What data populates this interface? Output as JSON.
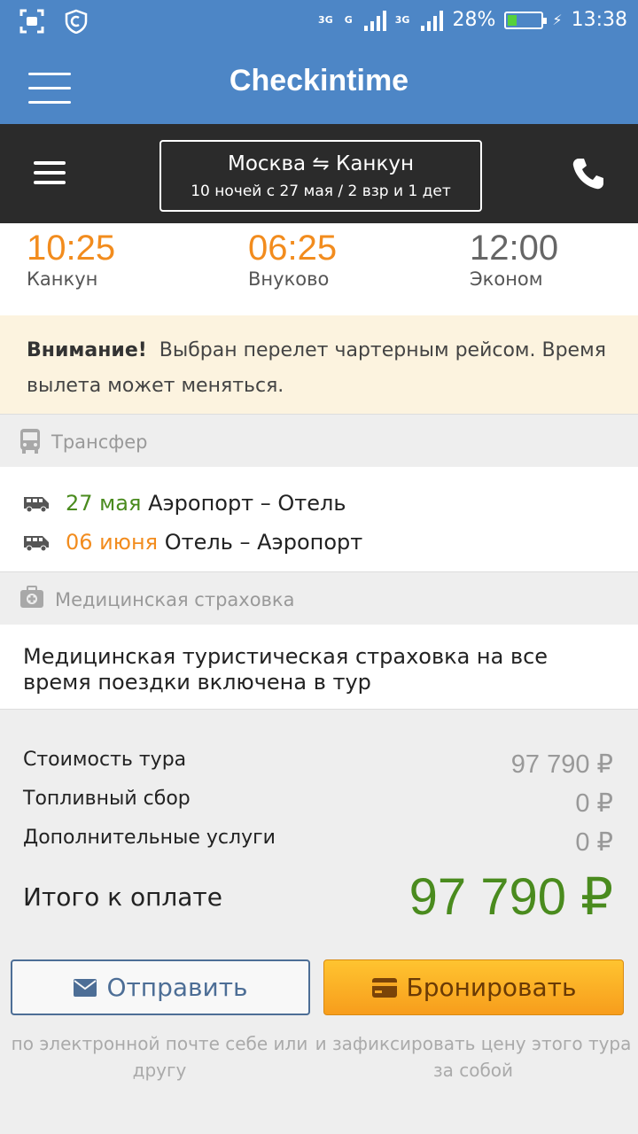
{
  "statusbar": {
    "net1_label": "3G",
    "net2_label": "G",
    "net3_label": "3G",
    "battery_text": "28%",
    "battery_level": 0.28,
    "time": "13:38"
  },
  "appbar": {
    "title": "Checkintime"
  },
  "search": {
    "route_from": "Москва",
    "route_arrow": "⇋",
    "route_to": "Канкун",
    "details": "10 ночей с 27 мая / 2 взр и 1 дет"
  },
  "flight": [
    {
      "time": "10:25",
      "label": "Канкун",
      "color": "#f28c1e"
    },
    {
      "time": "06:25",
      "label": "Внуково",
      "color": "#f28c1e"
    },
    {
      "time": "12:00",
      "label": "Эконом",
      "color": "#666666"
    }
  ],
  "warning": {
    "bold": "Внимание!",
    "text": "Выбран перелет чартерным рейсом. Время вылета может меняться."
  },
  "transfer": {
    "heading": "Трансфер",
    "rows": [
      {
        "date": "27 мая",
        "route": "Аэропорт – Отель",
        "date_color": "#4a8b1e"
      },
      {
        "date": "06 июня",
        "route": "Отель – Аэропорт",
        "date_color": "#f28c1e"
      }
    ]
  },
  "insurance": {
    "heading": "Медицинская страховка",
    "text": "Медицинская туристическая страховка на все время поездки включена в тур"
  },
  "prices": {
    "rows": [
      {
        "label": "Стоимость тура",
        "value": "97 790 ₽"
      },
      {
        "label": "Топливный сбор",
        "value": "0 ₽"
      },
      {
        "label": "Дополнительные услуги",
        "value": "0 ₽"
      }
    ],
    "total_label": "Итого к оплате",
    "total_value": "97 790 ₽"
  },
  "actions": {
    "send_label": "Отправить",
    "send_hint": "по электронной почте себе или другу",
    "book_label": "Бронировать",
    "book_hint": "и зафиксировать цену этого тура за собой"
  }
}
